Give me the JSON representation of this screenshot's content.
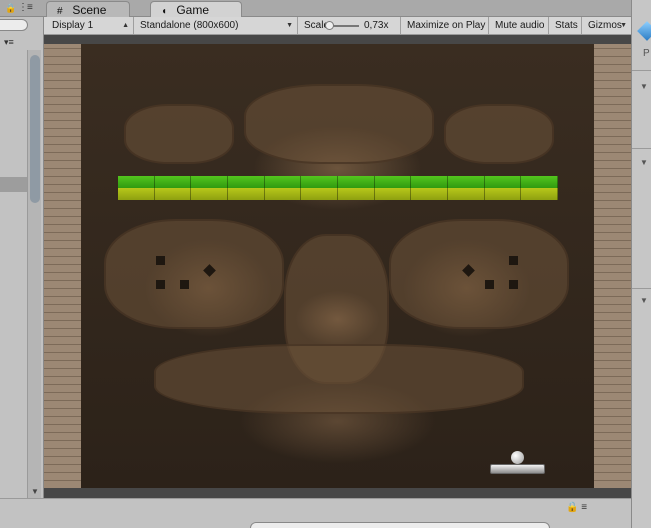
{
  "tabs": [
    {
      "label": "Scene",
      "icon": "scene-grid-icon"
    },
    {
      "label": "Game",
      "icon": "game-pacman-icon"
    }
  ],
  "toolbar": {
    "display": "Display 1",
    "aspect": "Standalone (800x600)",
    "scale_label": "Scale",
    "scale_value": "0,73x",
    "maximize": "Maximize on Play",
    "mute": "Mute audio",
    "stats": "Stats",
    "gizmos": "Gizmos"
  },
  "right_panel": {
    "letter": "P"
  },
  "game": {
    "brick_rows": [
      {
        "color": "#3fae16",
        "count": 12
      },
      {
        "color": "#a6b816",
        "count": 12
      }
    ]
  }
}
